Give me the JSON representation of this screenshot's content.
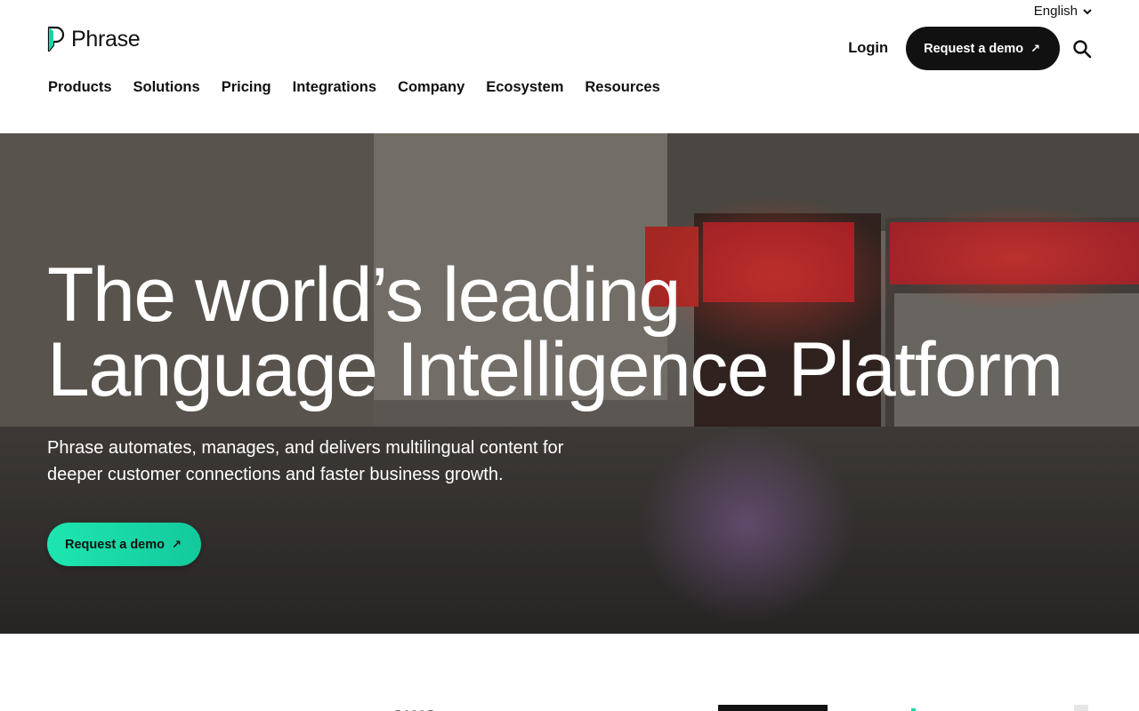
{
  "header": {
    "language": "English",
    "brand": "Phrase",
    "nav": [
      "Products",
      "Solutions",
      "Pricing",
      "Integrations",
      "Company",
      "Ecosystem",
      "Resources"
    ],
    "login": "Login",
    "demo_button": "Request a demo",
    "arrow": "↗"
  },
  "hero": {
    "title_line1": "The world’s leading",
    "title_line2": "Language Intelligence Platform",
    "subtitle": "Phrase automates, manages, and delivers multilingual content for deeper customer connections and faster business growth.",
    "cta": "Request a demo",
    "arrow": "↗"
  },
  "logos": {
    "aws": "aws"
  },
  "colors": {
    "accent": "#1ee6b0",
    "dark": "#111111"
  }
}
